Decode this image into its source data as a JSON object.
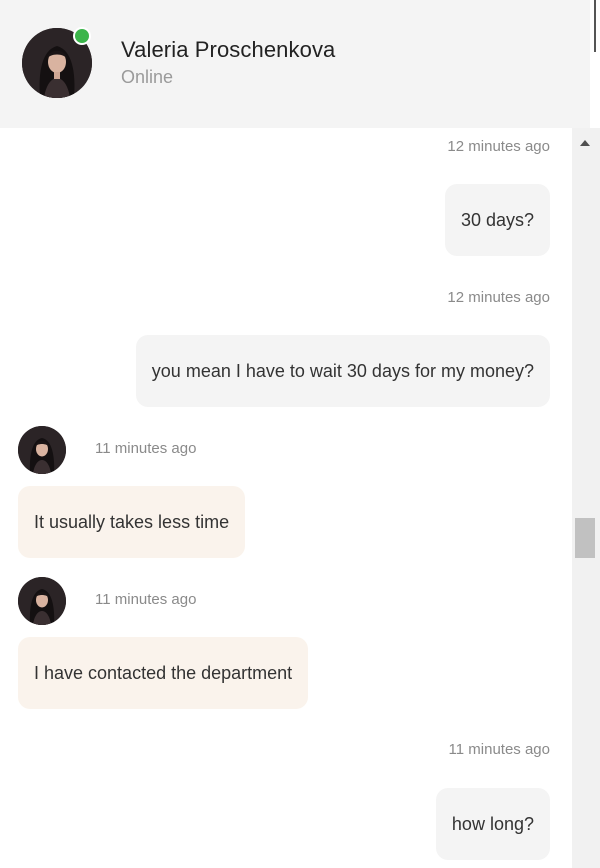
{
  "contact": {
    "name": "Valeria Proschenkova",
    "status": "Online"
  },
  "colors": {
    "online": "#3bb54a",
    "incoming_bubble": "#faf3ec",
    "outgoing_bubble": "#f4f4f4"
  },
  "messages": [
    {
      "direction": "out",
      "time": "12 minutes ago",
      "text": "30 days?"
    },
    {
      "direction": "out",
      "time": "12 minutes ago",
      "text": "you mean I have to wait 30 days for my money?"
    },
    {
      "direction": "in",
      "time": "11 minutes ago",
      "text": "It usually takes less time"
    },
    {
      "direction": "in",
      "time": "11 minutes ago",
      "text": "I have contacted the department"
    },
    {
      "direction": "out",
      "time": "11 minutes ago",
      "text": "how long?"
    }
  ]
}
